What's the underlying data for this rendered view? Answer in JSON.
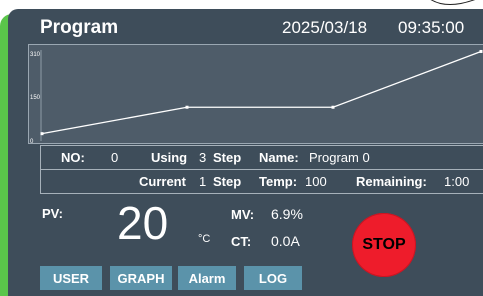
{
  "header": {
    "title": "Program",
    "date": "2025/03/18",
    "time": "09:35:00"
  },
  "chart_data": {
    "type": "line",
    "yticks": [
      "310",
      "150",
      "0"
    ],
    "ylim": [
      0,
      310
    ],
    "series": [
      {
        "x": [
          0,
          1,
          2,
          3
        ],
        "y": [
          25,
          115,
          115,
          305
        ]
      }
    ]
  },
  "program_info": {
    "no_label": "NO:",
    "no_value": "0",
    "using_label": "Using",
    "using_value": "3",
    "step_label": "Step",
    "name_label": "Name:",
    "name_value": "Program 0",
    "current_label": "Current",
    "current_value": "1",
    "current_step_label": "Step",
    "temp_label": "Temp:",
    "temp_value": "100",
    "remaining_label": "Remaining:",
    "remaining_value": "1:00"
  },
  "readout": {
    "pv_label": "PV:",
    "pv_value": "20",
    "pv_unit": "°C",
    "mv_label": "MV:",
    "mv_value": "6.9%",
    "ct_label": "CT:",
    "ct_value": "0.0A"
  },
  "stop_label": "STOP",
  "nav": [
    "USER",
    "GRAPH",
    "Alarm",
    "LOG"
  ],
  "colors": {
    "panel": "#3e4d5a",
    "accent_green": "#5ac54a",
    "stop_red": "#ee1c2b",
    "nav_button": "#5b93aa"
  }
}
